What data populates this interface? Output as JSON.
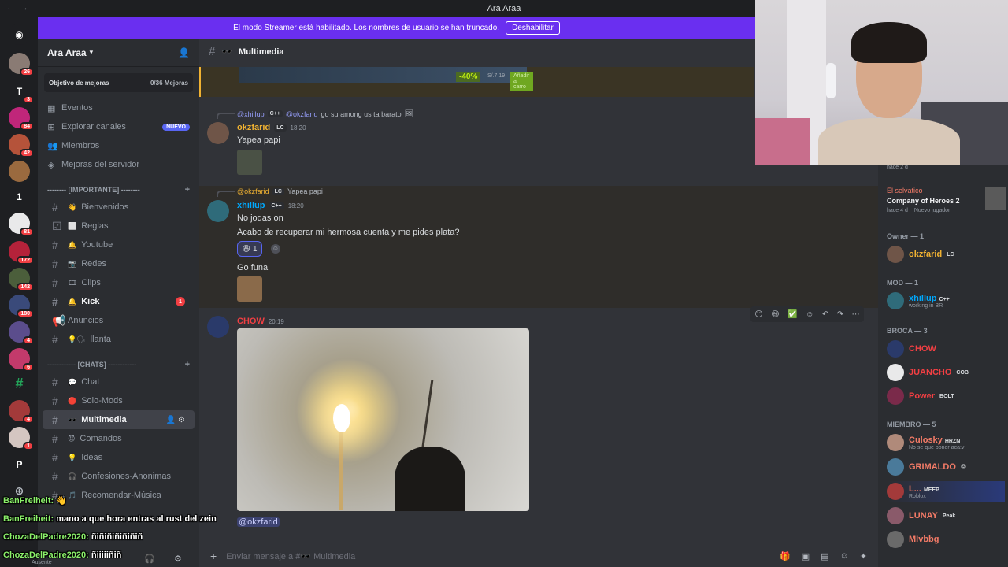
{
  "window": {
    "title": "Ara Araa"
  },
  "banner": {
    "text": "El modo Streamer está habilitado. Los nombres de usuario se han truncado.",
    "button": "Deshabilitar"
  },
  "rail": {
    "servers": [
      {
        "initial": "",
        "badge": "26",
        "color": "#8a7b74"
      },
      {
        "initial": "T",
        "badge": "3",
        "color": "#1e1f22"
      },
      {
        "initial": "",
        "badge": "84",
        "color": "#c0267a"
      },
      {
        "initial": "",
        "badge": "42",
        "color": "#b5533a"
      },
      {
        "initial": "",
        "badge": "",
        "color": "#9a6a3f"
      },
      {
        "initial": "1",
        "badge": "",
        "color": "#1e1f22"
      },
      {
        "initial": "",
        "badge": "81",
        "color": "#e9e9ea"
      },
      {
        "initial": "",
        "badge": "172",
        "color": "#b4223a"
      },
      {
        "initial": "",
        "badge": "142",
        "color": "#4b5e3b"
      },
      {
        "initial": "",
        "badge": "180",
        "color": "#3a4a7a"
      },
      {
        "initial": "",
        "badge": "4",
        "color": "#5b4d8c"
      },
      {
        "initial": "",
        "badge": "6",
        "color": "#c33a6b"
      },
      {
        "initial": "#",
        "badge": "",
        "color": "#1e1f22"
      },
      {
        "initial": "",
        "badge": "4",
        "color": "#a33a3a"
      },
      {
        "initial": "",
        "badge": "1",
        "color": "#d4c6c1"
      },
      {
        "initial": "P",
        "badge": "",
        "color": "#1e1f22"
      }
    ]
  },
  "server": {
    "name": "Ara Araa",
    "goal_label": "Objetivo de mejoras",
    "goal_count": "0/36 Mejoras"
  },
  "menu": [
    {
      "label": "Eventos",
      "icon": "calendar-icon",
      "new": ""
    },
    {
      "label": "Explorar canales",
      "icon": "compass-icon",
      "new": "NUEVO"
    },
    {
      "label": "Miembros",
      "icon": "people-icon",
      "new": ""
    },
    {
      "label": "Mejoras del servidor",
      "icon": "boost-icon",
      "new": ""
    }
  ],
  "categories": {
    "important": "-------- [IMPORTANTE] --------",
    "chats": "------------ [CHATS] ------------"
  },
  "channels_important": [
    {
      "label": "Bienvenidos",
      "emoji": "👋",
      "bold": false,
      "unread": ""
    },
    {
      "label": "Reglas",
      "emoji": "☑️ ⬜",
      "bold": false,
      "unread": ""
    },
    {
      "label": "Youtube",
      "emoji": "🔔",
      "bold": false,
      "unread": ""
    },
    {
      "label": "Redes",
      "emoji": "",
      "bold": false,
      "unread": ""
    },
    {
      "label": "Clips",
      "emoji": "",
      "bold": false,
      "unread": ""
    },
    {
      "label": "Kick",
      "emoji": "🔔",
      "bold": true,
      "unread": "1"
    },
    {
      "label": "Anuncios",
      "emoji": "📢",
      "bold": false,
      "unread": ""
    },
    {
      "label": "llanta",
      "emoji": "💡🗣",
      "bold": false,
      "unread": ""
    }
  ],
  "channels_chats": [
    {
      "label": "Chat",
      "emoji": "💬",
      "active": false
    },
    {
      "label": "Solo-Mods",
      "emoji": "🔴",
      "active": false
    },
    {
      "label": "Multimedia",
      "emoji": "🕶️",
      "active": true
    },
    {
      "label": "Comandos",
      "emoji": "😈",
      "active": false
    },
    {
      "label": "Ideas",
      "emoji": "💡",
      "active": false
    },
    {
      "label": "Confesiones-Anonimas",
      "emoji": "🎧",
      "active": false
    },
    {
      "label": "Recomendar-Música",
      "emoji": "🎵",
      "active": false
    }
  ],
  "channel": {
    "name": "Multimedia"
  },
  "store_embed": {
    "discount": "-40%",
    "old_price": "S/.7.19",
    "button": "Añadir al carro"
  },
  "messages": {
    "m1": {
      "reply_user": "@xhillup",
      "reply_tag": "C++",
      "reply_mention": "@okzfarid",
      "reply_text": "go su among us ta barato",
      "user": "okzfarid",
      "tag": "LC",
      "time": "18:20",
      "text": "Yapea papi"
    },
    "m2": {
      "reply_user": "@okzfarid",
      "reply_tag": "LC",
      "reply_text": "Yapea papi",
      "user": "xhillup",
      "tag": "C++",
      "time": "18:20",
      "text1": "No jodas on",
      "text2": "Acabo de recuperar mi hermosa cuenta y me pides plata?",
      "reaction_emoji": "😆",
      "reaction_count": "1",
      "text3": "Go funa"
    },
    "m3": {
      "user": "CHOW",
      "time": "20:19",
      "mention": "@okzfarid"
    }
  },
  "composer": {
    "placeholder": "Enviar mensaje a #🕶️ Multimedia"
  },
  "activity": [
    {
      "meta": "hace 2 d"
    },
    {
      "user": "El selvatico",
      "game": "Company of Heroes 2",
      "meta": "hace 4 d",
      "extra": "Nuevo jugador"
    }
  ],
  "member_groups": [
    {
      "title": "Owner — 1",
      "members": [
        {
          "name": "okzfarid",
          "tag": "LC",
          "color": "#f0b232",
          "sub": ""
        }
      ]
    },
    {
      "title": "MOD — 1",
      "members": [
        {
          "name": "xhillup",
          "tag": "C++",
          "color": "#00a8fc",
          "sub": "working in BR"
        }
      ]
    },
    {
      "title": "BROCA — 3",
      "members": [
        {
          "name": "CHOW",
          "tag": "",
          "color": "#f23f43",
          "sub": ""
        },
        {
          "name": "JUANCHO",
          "tag": "COB",
          "color": "#f23f43",
          "sub": ""
        },
        {
          "name": "Power",
          "tag": "BOLT",
          "color": "#f23f43",
          "sub": ""
        }
      ]
    },
    {
      "title": "MIEMBRO — 5",
      "members": [
        {
          "name": "Culosky",
          "tag": "HRZN",
          "color": "#f47b67",
          "sub": "No se que poner aca:v"
        },
        {
          "name": "GRIMALDO",
          "tag": "😡",
          "color": "#f47b67",
          "sub": ""
        },
        {
          "name": "L...",
          "tag": "MEEP",
          "color": "#f47b67",
          "sub": "Roblox"
        },
        {
          "name": "LUNAY",
          "tag": "Peak",
          "color": "#f47b67",
          "sub": ""
        },
        {
          "name": "MIvbbg",
          "tag": "",
          "color": "#f47b67",
          "sub": ""
        }
      ]
    }
  ],
  "twitch_chat": [
    {
      "user": "BanFreiheit:",
      "text": "👋"
    },
    {
      "user": "BanFreiheit:",
      "text": "mano a que hora entras al rust del zein"
    },
    {
      "user": "ChozaDelPadre2020:",
      "text": "ñiñiñiñiñiñiñ"
    },
    {
      "user": "ChozaDelPadre2020:",
      "text": "ñiiiiiñiñ"
    }
  ],
  "user_status": "Ausente",
  "colors": {
    "accent": "#5865f2",
    "banner": "#6a2ff0",
    "owner": "#f0b232",
    "mod": "#00a8fc",
    "broca": "#f23f43",
    "member": "#f47b67"
  }
}
